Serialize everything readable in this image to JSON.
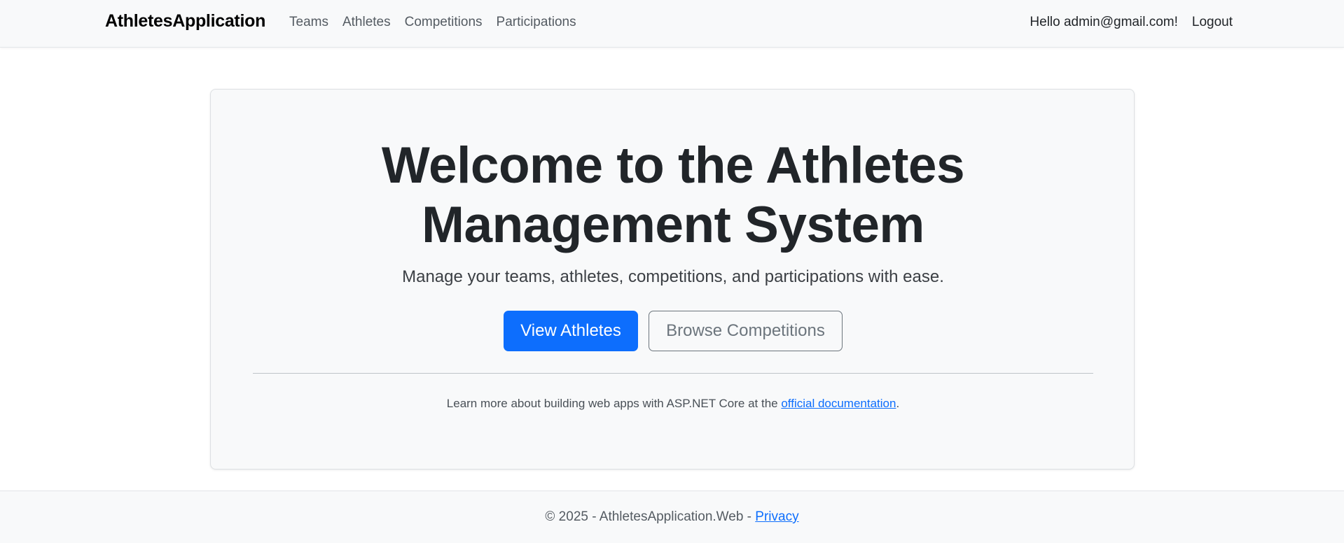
{
  "navbar": {
    "brand": "AthletesApplication",
    "links": [
      "Teams",
      "Athletes",
      "Competitions",
      "Participations"
    ],
    "greeting": "Hello admin@gmail.com!",
    "logout": "Logout"
  },
  "hero": {
    "title_line1": "Welcome to the Athletes",
    "title_line2": "Management System",
    "subtitle": "Manage your teams, athletes, competitions, and participations with ease.",
    "primary_button": "View Athletes",
    "secondary_button": "Browse Competitions",
    "learn_prefix": "Learn more about building web apps with ASP.NET Core at the ",
    "learn_link": "official documentation",
    "learn_suffix": "."
  },
  "footer": {
    "text": "© 2025 - AthletesApplication.Web - ",
    "privacy": "Privacy"
  },
  "colors": {
    "primary": "#0d6efd",
    "secondary": "#6c757d",
    "light_bg": "#f8f9fa"
  }
}
